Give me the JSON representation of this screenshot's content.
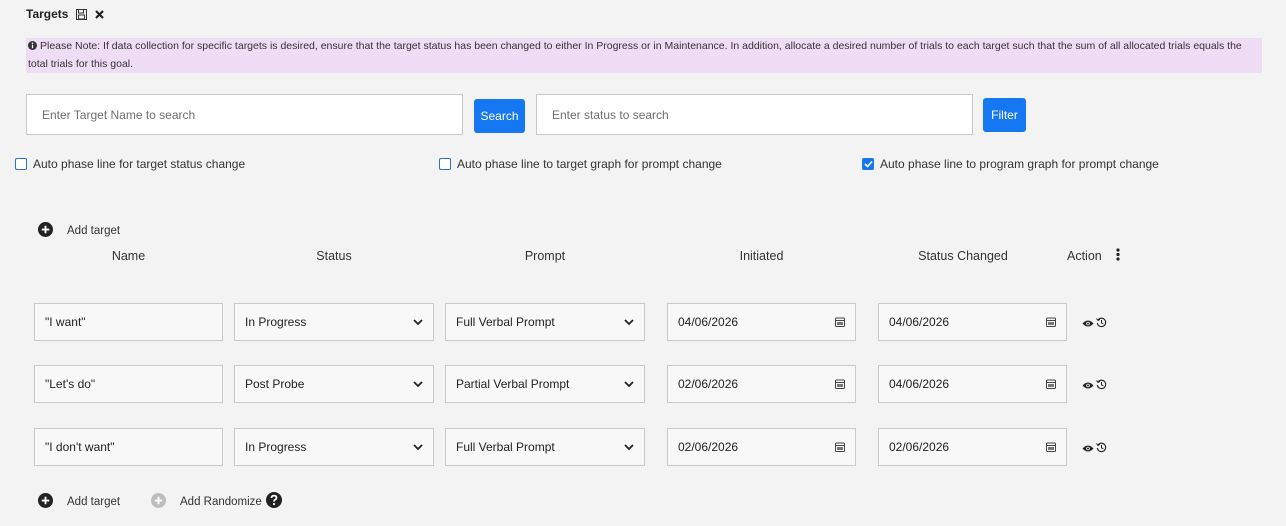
{
  "header": {
    "title": "Targets"
  },
  "note": "Please Note: If data collection for specific targets is desired, ensure that the target status has been changed to either In Progress or in Maintenance. In addition, allocate a desired number of trials to each target such that the sum of all allocated trials equals the total trials for this goal.",
  "search": {
    "name_placeholder": "Enter Target Name to search",
    "search_label": "Search",
    "status_placeholder": "Enter status to search",
    "filter_label": "Filter"
  },
  "checkboxes": [
    {
      "label": "Auto phase line for target status change",
      "checked": false
    },
    {
      "label": "Auto phase line to target graph for prompt change",
      "checked": false
    },
    {
      "label": "Auto phase line to program graph for prompt change",
      "checked": true
    }
  ],
  "add_target_label": "Add target",
  "add_randomize_label": "Add Randomize",
  "columns": {
    "name": "Name",
    "status": "Status",
    "prompt": "Prompt",
    "initiated": "Initiated",
    "status_changed": "Status Changed",
    "action": "Action"
  },
  "rows": [
    {
      "name": "\"I want\"",
      "status": "In Progress",
      "prompt": "Full Verbal Prompt",
      "initiated": "04/06/2026",
      "status_changed": "04/06/2026"
    },
    {
      "name": "\"Let's do\"",
      "status": "Post Probe",
      "prompt": "Partial Verbal Prompt",
      "initiated": "02/06/2026",
      "status_changed": "04/06/2026"
    },
    {
      "name": "\"I don't want\"",
      "status": "In Progress",
      "prompt": "Full Verbal Prompt",
      "initiated": "02/06/2026",
      "status_changed": "02/06/2026"
    }
  ],
  "colors": {
    "accent": "#1677f2",
    "note_bg": "#efdcf5",
    "page_bg": "#f3f3f3"
  }
}
